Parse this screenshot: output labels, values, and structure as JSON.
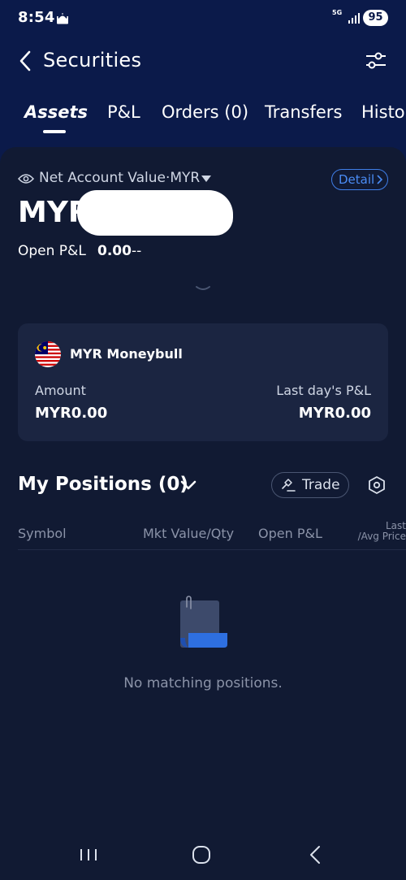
{
  "status_bar": {
    "time": "8:54",
    "network": "5G",
    "battery": "95"
  },
  "header": {
    "title": "Securities"
  },
  "tabs": [
    {
      "label": "Assets",
      "active": true
    },
    {
      "label": "P&L",
      "active": false
    },
    {
      "label": "Orders (0)",
      "active": false
    },
    {
      "label": "Transfers",
      "active": false
    },
    {
      "label": "Histor",
      "active": false
    }
  ],
  "account": {
    "net_value_label": "Net Account Value·MYR",
    "detail_label": "Detail",
    "net_value": "MYR",
    "open_pl_label": "Open P&L",
    "open_pl_value": "0.00",
    "open_pl_change": "--"
  },
  "moneybull": {
    "title": "MYR Moneybull",
    "amount_label": "Amount",
    "amount_value": "MYR0.00",
    "last_pl_label": "Last day's P&L",
    "last_pl_value": "MYR0.00"
  },
  "positions": {
    "title": "My Positions (0)",
    "trade_label": "Trade",
    "columns": {
      "symbol": "Symbol",
      "mkt_value": "Mkt Value/Qty",
      "open_pl": "Open P&L",
      "last_line1": "Last",
      "last_line2": "/Avg Price"
    },
    "empty_text": "No matching positions."
  },
  "colors": {
    "header_bg": "#0b1a4a",
    "content_bg": "#111a33",
    "card_bg": "#1b2541",
    "accent": "#4a8cf5",
    "muted_text": "#8b93a8"
  }
}
